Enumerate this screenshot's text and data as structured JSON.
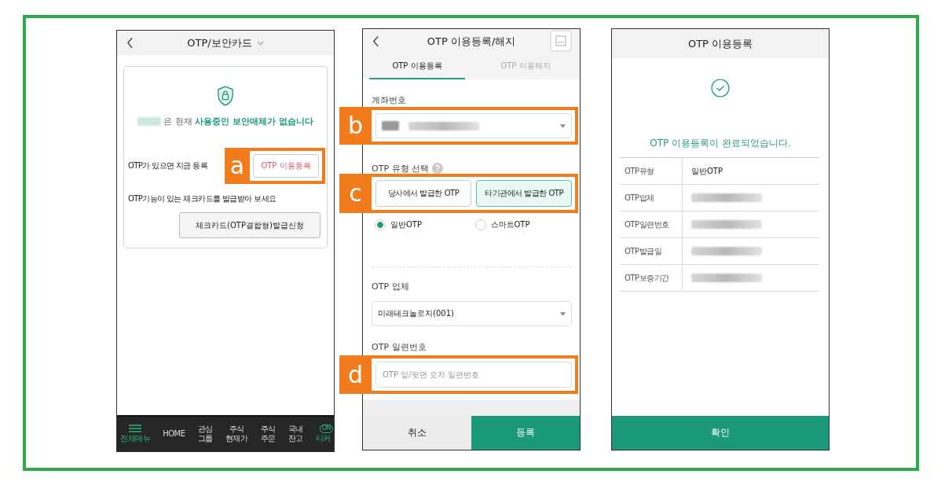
{
  "otp_card_screen": {
    "title": "OTP/보안카드",
    "notice": "은 현재 **사용중인 보안매체가 없습니다**",
    "register_prompt": "OTP가 있으면 지금 등록",
    "register_button": {
      "label": "OTP 이용등록",
      "callout": "a"
    },
    "card_prompt": "OTP기능이 있는 체크카드를 발급받아 보세요",
    "card_button": "체크카드(OTP결합형)발급신청",
    "nav": [
      {
        "label": "전체메뉴",
        "kind": "menu",
        "selected": true
      },
      {
        "label": "HOME",
        "kind": "text",
        "selected": false
      },
      {
        "label": "관심\n그룹",
        "kind": "text",
        "selected": false
      },
      {
        "label": "주식\n현재가",
        "kind": "text",
        "selected": false
      },
      {
        "label": "주식\n주문",
        "kind": "text",
        "selected": false
      },
      {
        "label": "국내\n잔고",
        "kind": "text",
        "selected": false
      },
      {
        "label": "티커",
        "kind": "toggle",
        "badge": "ON",
        "selected": true
      }
    ]
  },
  "register_screen": {
    "title": "OTP 이용등록/해지",
    "tabs": [
      {
        "label": "OTP 이용등록",
        "selected": true
      },
      {
        "label": "OTP 이용해지",
        "selected": false
      }
    ],
    "account_label": "계좌번호",
    "account_callout": "b",
    "type_label": "OTP 유형 선택",
    "type_callout": "c",
    "type_options": [
      {
        "label": "당사에서 발급한 OTP",
        "selected": false
      },
      {
        "label": "타기관에서 발급한 OTP",
        "selected": true
      }
    ],
    "radios": [
      {
        "label": "일반OTP",
        "selected": true
      },
      {
        "label": "스마트OTP",
        "selected": false
      }
    ],
    "vendor_label": "OTP 업체",
    "vendor_value": "미래테크놀로지(001)",
    "serial_label": "OTP 일련번호",
    "serial_placeholder": "OTP 앞/뒷면 숫자 일련번호",
    "serial_callout": "d",
    "buttons": [
      "취소",
      "등록"
    ]
  },
  "complete_screen": {
    "title": "OTP 이용등록",
    "message": "OTP 이용등록이 완료되었습니다.",
    "rows": [
      {
        "label": "OTP유형",
        "value": "일반OTP"
      },
      {
        "label": "OTP업체"
      },
      {
        "label": "OTP일련번호"
      },
      {
        "label": "OTP발급일"
      },
      {
        "label": "OTP보증기간"
      }
    ],
    "button": "확인"
  }
}
